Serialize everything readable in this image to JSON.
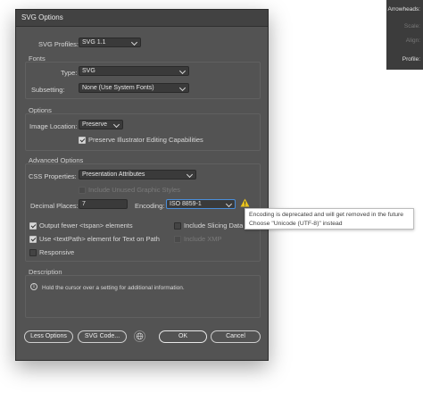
{
  "side_panel": {
    "items": [
      {
        "label": "Arrowheads:",
        "enabled": true
      },
      {
        "label": "Scale:",
        "enabled": false
      },
      {
        "label": "Align:",
        "enabled": false
      },
      {
        "label": "Profile:",
        "enabled": true
      }
    ]
  },
  "dialog": {
    "title": "SVG Options",
    "svg_profiles": {
      "label": "SVG Profiles:",
      "value": "SVG 1.1"
    },
    "fonts": {
      "section": "Fonts",
      "type": {
        "label": "Type:",
        "value": "SVG"
      },
      "subsetting": {
        "label": "Subsetting:",
        "value": "None (Use System Fonts)"
      }
    },
    "options": {
      "section": "Options",
      "image_location": {
        "label": "Image Location:",
        "value": "Preserve"
      },
      "preserve_editing": {
        "label": "Preserve Illustrator Editing Capabilities",
        "checked": true
      }
    },
    "advanced": {
      "section": "Advanced Options",
      "css_properties": {
        "label": "CSS Properties:",
        "value": "Presentation Attributes"
      },
      "include_unused_styles": {
        "label": "Include Unused Graphic Styles",
        "checked": false,
        "enabled": false
      },
      "decimal_places": {
        "label": "Decimal Places:",
        "value": "7"
      },
      "encoding": {
        "label": "Encoding:",
        "value": "ISO 8859-1"
      },
      "output_fewer_tspan": {
        "label": "Output fewer <tspan> elements",
        "checked": true
      },
      "use_textpath": {
        "label": "Use <textPath> element for Text on Path",
        "checked": true
      },
      "responsive": {
        "label": "Responsive",
        "checked": false
      },
      "include_slicing": {
        "label": "Include Slicing Data",
        "checked": false
      },
      "include_xmp": {
        "label": "Include XMP",
        "checked": false,
        "enabled": false
      }
    },
    "description": {
      "section": "Description",
      "text": "Hold the cursor over a setting for additional information."
    },
    "buttons": {
      "less_options": "Less Options",
      "svg_code": "SVG Code...",
      "ok": "OK",
      "cancel": "Cancel"
    }
  },
  "tooltip": {
    "line1": "Encoding is deprecated and will get removed in the future",
    "line2": "Choose \"Unicode (UTF-8)\" instead"
  },
  "icons": {
    "warning": "warning-triangle-icon",
    "info": "info-icon",
    "globe": "globe-icon"
  },
  "colors": {
    "dialog_bg": "#535353",
    "accent_focus": "#4a8edb",
    "warning": "#e8c21c"
  }
}
